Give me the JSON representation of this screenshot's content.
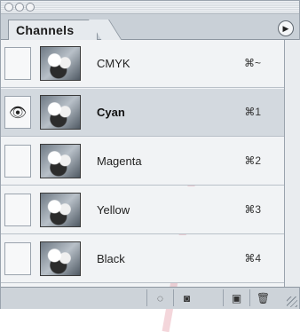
{
  "window": {
    "controls": [
      "close",
      "minimize",
      "zoom"
    ]
  },
  "panel": {
    "tab_label": "Channels",
    "menu_icon": "triangle-right-icon"
  },
  "channels": [
    {
      "name": "CMYK",
      "shortcut": "⌘~",
      "visible": false,
      "selected": false
    },
    {
      "name": "Cyan",
      "shortcut": "⌘1",
      "visible": true,
      "selected": true
    },
    {
      "name": "Magenta",
      "shortcut": "⌘2",
      "visible": false,
      "selected": false
    },
    {
      "name": "Yellow",
      "shortcut": "⌘3",
      "visible": false,
      "selected": false
    },
    {
      "name": "Black",
      "shortcut": "⌘4",
      "visible": false,
      "selected": false
    }
  ],
  "bottom_buttons": [
    {
      "icon": "load-selection-icon",
      "glyph": "◌"
    },
    {
      "icon": "save-selection-icon",
      "glyph": "◙"
    },
    {
      "icon": "new-channel-icon",
      "glyph": "▣"
    },
    {
      "icon": "trash-icon",
      "glyph": "🗑"
    }
  ],
  "colors": {
    "selected_row": "#d3d9df",
    "panel_bg": "#d7dde3"
  }
}
